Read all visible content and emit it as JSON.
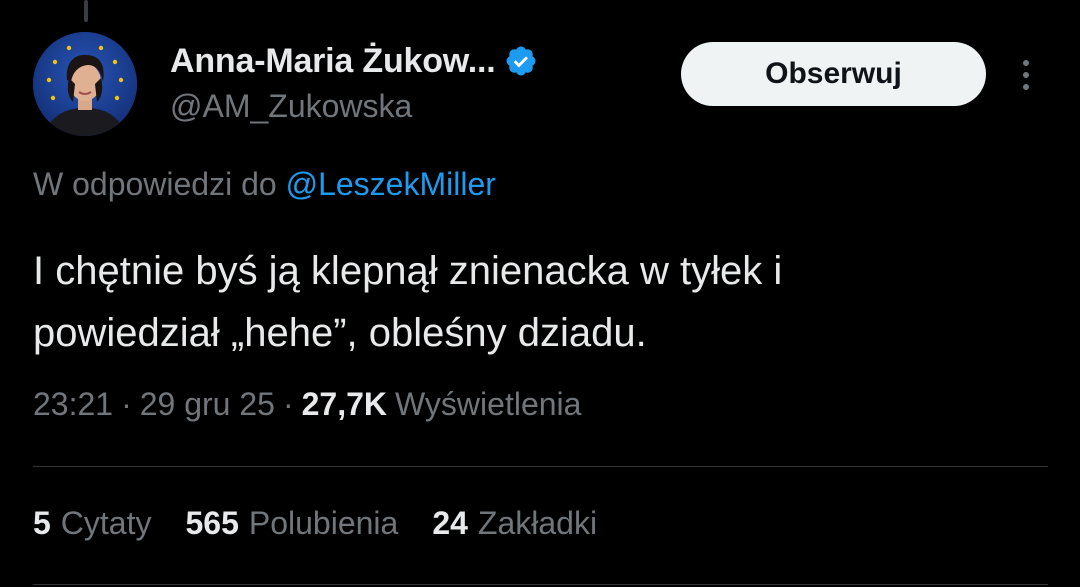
{
  "author": {
    "display_name": "Anna-Maria Żukow...",
    "handle": "@AM_Zukowska",
    "verified_icon": "verified-badge-icon",
    "accent": "#1d9bf0"
  },
  "follow_button": {
    "label": "Obserwuj"
  },
  "more_menu_icon": "more-vertical-icon",
  "reply": {
    "prefix": "W odpowiedzi do ",
    "mention": "@LeszekMiller"
  },
  "tweet": {
    "lines": [
      "I chętnie byś ją klepnął znienacka w tyłek i",
      "powiedział „hehe”, obleśny dziadu."
    ]
  },
  "meta": {
    "time": "23:21",
    "separator": "·",
    "date": "29 gru 25",
    "views_count": "27,7K",
    "views_label": "Wyświetlenia"
  },
  "stats": [
    {
      "count": "5",
      "label": "Cytaty"
    },
    {
      "count": "565",
      "label": "Polubienia"
    },
    {
      "count": "24",
      "label": "Zakładki"
    }
  ],
  "colors": {
    "background": "#000000",
    "text_primary": "#e7e9ea",
    "text_secondary": "#71767b",
    "link": "#1d9bf0",
    "button_bg": "#eff3f4",
    "divider": "#2f3336"
  }
}
